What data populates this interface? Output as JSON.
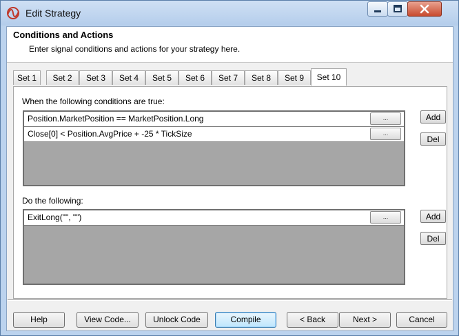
{
  "window": {
    "title": "Edit Strategy"
  },
  "header": {
    "title": "Conditions and Actions",
    "subtitle": "Enter signal conditions and actions for your strategy here."
  },
  "tabs": [
    {
      "label": "Set 1"
    },
    {
      "label": "Set 2"
    },
    {
      "label": "Set 3"
    },
    {
      "label": "Set 4"
    },
    {
      "label": "Set 5"
    },
    {
      "label": "Set 6"
    },
    {
      "label": "Set 7"
    },
    {
      "label": "Set 8"
    },
    {
      "label": "Set 9"
    },
    {
      "label": "Set 10"
    }
  ],
  "active_tab": "Set 10",
  "conditions": {
    "label": "When the following conditions are true:",
    "rows": [
      {
        "text": "Position.MarketPosition == MarketPosition.Long",
        "button": "..."
      },
      {
        "text": "Close[0] < Position.AvgPrice + -25 * TickSize",
        "button": "..."
      }
    ],
    "add_label": "Add",
    "del_label": "Del"
  },
  "actions": {
    "label": "Do the following:",
    "rows": [
      {
        "text": "ExitLong(\"\", \"\")",
        "button": "..."
      }
    ],
    "add_label": "Add",
    "del_label": "Del"
  },
  "footer": {
    "help": "Help",
    "view_code": "View Code...",
    "unlock_code": "Unlock Code",
    "compile": "Compile",
    "back": "< Back",
    "next": "Next >",
    "cancel": "Cancel"
  },
  "colors": {
    "titlebar": "#bcd3ee",
    "grid_background": "#a6a6a6",
    "close_button": "#c84b2f",
    "default_button_border": "#3c7fb1"
  },
  "icons": {
    "app": "strategy-logo-icon",
    "minimize": "minimize-icon",
    "maximize": "maximize-icon",
    "close": "close-icon"
  }
}
